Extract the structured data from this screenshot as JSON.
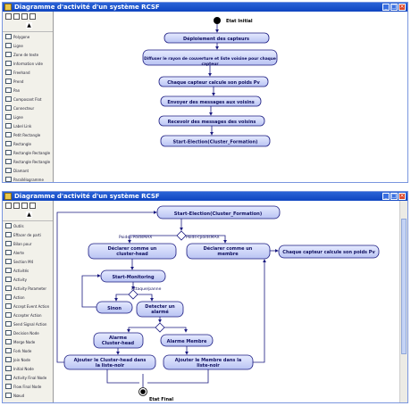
{
  "window1": {
    "title": "Diagramme d'activité d'un système RCSF",
    "palette": [
      "Polygone",
      "Ligne",
      "Zone de texte",
      "Information vide",
      "Freehand",
      "Prend",
      "Pan",
      "Composant Flot",
      "Connecteur",
      "Ligne",
      "Label Link",
      "Petit Rectangle",
      "Rectangle",
      "Rectangle Rectangle",
      "Rectangle Rectangle",
      "Diamant",
      "Parallélogramme",
      "Trapézoïde",
      "Intersection Triangle",
      "Petit Ellipse"
    ],
    "nodes": {
      "start_label": "Etat Initial",
      "n1": "Déploiement des capteurs",
      "n2": "Diffuser le rayon de couverture et liste voisine pour chaque capteur",
      "n3": "Chaque capteur calcule son poids Pv",
      "n4": "Envoyer des messages aux voisins",
      "n5": "Recevoir des messages des voisins",
      "n6": "Start-Election(Cluster_Formation)"
    }
  },
  "window2": {
    "title": "Diagramme d'activité d'un système RCSF",
    "palette": [
      "Outils",
      "Effacer de parti",
      "Bilan pour",
      "Alerte",
      "Section M4",
      "Activités",
      "Activity",
      "Activity Parameter",
      "Action",
      "Accept Event Action",
      "Accepter Action",
      "Send Signal Action",
      "Decision Node",
      "Merge Node",
      "Fork Node",
      "Join Node",
      "Initial Node",
      "Activity Final Node",
      "Flow Final Node",
      "Nœud"
    ],
    "nodes": {
      "se": "Start-Election(Cluster_Formation)",
      "dch": "Déclarer comme un cluster-head",
      "dm": "Déclarer comme un membre",
      "ccp": "Chaque capteur calcule son poids Pv",
      "sm": "Start-Monitoring",
      "sinon": "Sinon",
      "det": "Detecter un alarmé",
      "ach": "Alarme Cluster-head",
      "am": "Alarme Membre",
      "ach_list": "Ajouter le Cluster-head dans la liste-noir",
      "am_list": "Ajouter le Membre dans la liste-noir",
      "final_label": "Etat Final",
      "g1": "Poids=PoidsMAX",
      "g2": "Poids<poidsMAX",
      "g3": "Attaque/panne"
    }
  }
}
